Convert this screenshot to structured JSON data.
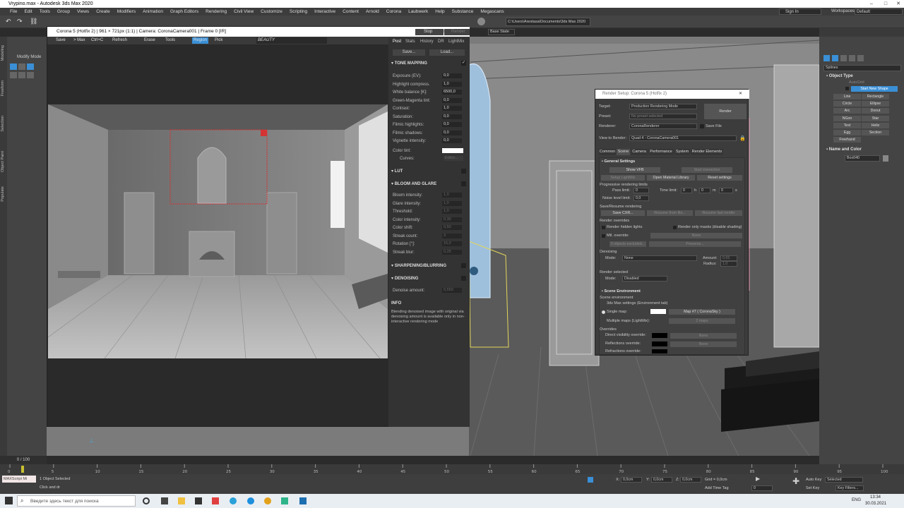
{
  "app": {
    "title": "Vrypino.max - Autodesk 3ds Max 2020"
  },
  "menu": [
    "File",
    "Edit",
    "Tools",
    "Group",
    "Views",
    "Create",
    "Modifiers",
    "Animation",
    "Graph Editors",
    "Rendering",
    "Civil View",
    "Customize",
    "Scripting",
    "Interactive",
    "Content",
    "Arnold",
    "Corona",
    "Laubwerk",
    "Help",
    "Substance",
    "Megascans"
  ],
  "topright": {
    "signin": "Sign In",
    "workspaces_label": "Workspaces:",
    "workspace": "Default"
  },
  "toolbar": {
    "basestate": "Base State",
    "path": "C:\\Users\\Arestasa\\Documents\\3ds Max 2020"
  },
  "leftpanel": {
    "tabs": [
      "Modeling",
      "Freeform",
      "Selection",
      "Object Paint",
      "Populate"
    ],
    "modify_mode": "Modify Mode"
  },
  "vfb": {
    "title": "Corona 5 (Hotfix 2) | 961 × 721px (1:1) | Camera: CoronaCamera001 | Frame 0 [IR]",
    "buttons": [
      "Save",
      "> Max",
      "Ctrl+C",
      "Refresh",
      "Erase",
      "Tools",
      "Region",
      "Pick"
    ],
    "channel": "BEAUTY",
    "stop": "Stop",
    "render": "Render",
    "tabs": [
      "Post",
      "Stats",
      "History",
      "DR",
      "LightMix"
    ],
    "save": "Save...",
    "load": "Load...",
    "tone_mapping": "TONE MAPPING",
    "params": [
      {
        "label": "Exposure (EV):",
        "value": "0,0"
      },
      {
        "label": "Highlight compress.",
        "value": "1,0"
      },
      {
        "label": "White balance [K]:",
        "value": "6500,0"
      },
      {
        "label": "Green-Magenta tint:",
        "value": "0,0"
      },
      {
        "label": "Contrast:",
        "value": "1,0"
      },
      {
        "label": "Saturation:",
        "value": "0,0"
      },
      {
        "label": "Filmic highlights:",
        "value": "0,0"
      },
      {
        "label": "Filmic shadows:",
        "value": "0,0"
      },
      {
        "label": "Vignette intensity:",
        "value": "0,0"
      }
    ],
    "color_tint": "Color tint:",
    "curves": "Curves:",
    "curves_btn": "Editor...",
    "lut": "LUT",
    "bloom": "BLOOM AND GLARE",
    "bloom_params": [
      {
        "label": "Bloom intensity:",
        "value": "1,0"
      },
      {
        "label": "Glare intensity:",
        "value": "1,0"
      },
      {
        "label": "Threshold:",
        "value": "1,0"
      },
      {
        "label": "Color intensity:",
        "value": "0,30"
      },
      {
        "label": "Color shift:",
        "value": "0,50"
      },
      {
        "label": "Streak count:",
        "value": "3"
      },
      {
        "label": "Rotation [°]:",
        "value": "15,0"
      },
      {
        "label": "Streak blur:",
        "value": "0,25"
      }
    ],
    "sharpen": "SHARPENING/BLURRING",
    "denoising": "DENOISING",
    "denoise_amount": "Denoise amount:",
    "denoise_value": "0,650",
    "info_title": "INFO",
    "info_text": "Blending denoised image with original via denoising amount is available only in non-interactive rendering mode"
  },
  "render_setup": {
    "title": "Render Setup: Corona 5 (Hotfix 2)",
    "target_label": "Target:",
    "target": "Production Rendering Mode",
    "preset_label": "Preset:",
    "preset": "No preset selected",
    "renderer_label": "Renderer:",
    "renderer": "CoronaRenderer",
    "savefile": "Save File",
    "view_label": "View to Render:",
    "view": "Quad 4 - CoronaCamera001",
    "render_btn": "Render",
    "tabs": [
      "Common",
      "Scene",
      "Camera",
      "Performance",
      "System",
      "Render Elements"
    ],
    "general": "General Settings",
    "show_vfb": "Show VFB",
    "start_interactive": "Start interactive",
    "setup_lightmix": "Setup LightMix",
    "open_material": "Open Material Library",
    "reset": "Reset settings",
    "prog_limits": "Progressive rendering limits",
    "pass_limit": "Pass limit:",
    "pass_val": "0",
    "time_limit": "Time limit:",
    "h": "0",
    "hl": "h",
    "m": "0",
    "ml": "m",
    "s": "0",
    "sl": "s",
    "noise_label": "Noise level limit:",
    "noise_val": "0,0",
    "save_resume": "Save/Resume rendering",
    "save_cxr": "Save CXR...",
    "resume_file": "Resume from file...",
    "resume_last": "Resume last render",
    "overrides": "Render overrides",
    "hidden_lights": "Render hidden lights",
    "only_masks": "Render only masks (disable shading)",
    "mtl_override": "Mtl. override:",
    "none": "None",
    "objects_excluded": "0 objects excluded...",
    "preserve": "Preserve...",
    "denoising": "Denoising",
    "mode_label": "Mode:",
    "mode": "None",
    "amount_label": "Amount:",
    "amount_val": "0,65",
    "radius_label": "Radius:",
    "radius_val": "1,0",
    "render_selected": "Render selected",
    "rs_mode": "Disabled",
    "scene_env": "Scene Environment",
    "scene_env_sub": "Scene environment",
    "max_settings": "3ds Max settings (Environment tab)",
    "single_map": "Single map:",
    "map": "Map #7  ( CoronaSky )",
    "multiple_maps": "Multiple maps (LightMix):",
    "two_maps": "2 maps",
    "overrides2": "Overrides",
    "direct": "Direct visibility override:",
    "reflections": "Reflections override:",
    "refractions": "Refractions override:"
  },
  "cmd": {
    "category": "Splines",
    "object_type": "Object Type",
    "autogrid": "AutoGrid",
    "start_new": "Start New Shape",
    "buttons": [
      "Line",
      "Rectangle",
      "Circle",
      "Ellipse",
      "Arc",
      "Donut",
      "NGon",
      "Star",
      "Text",
      "Helix",
      "Egg",
      "Section",
      "Freehand"
    ],
    "name_color": "Name and Color",
    "name": "Box040"
  },
  "timeline": {
    "frames": "0 / 100",
    "ticks": [
      "0",
      "5",
      "10",
      "15",
      "20",
      "25",
      "30",
      "35",
      "40",
      "45",
      "50",
      "55",
      "60",
      "65",
      "70",
      "75",
      "80",
      "85",
      "90",
      "95",
      "100"
    ]
  },
  "status": {
    "script": "MAXScript Mi",
    "selected": "1 Object Selected",
    "hint": "Click and dr",
    "x": "0,0cm",
    "y": "0,0cm",
    "z": "0,0cm",
    "grid": "Grid = 0,0cm",
    "add_time_tag": "Add Time Tag",
    "frame": "0",
    "autokey": "Auto Key",
    "setkey": "Set Key",
    "selected_drop": "Selected",
    "keyfilters": "Key Filters..."
  },
  "taskbar": {
    "search": "Введите здесь текст для поиска",
    "lang": "ENG",
    "time": "13:34",
    "date": "30.03.2021"
  },
  "colors": {
    "accent": "#3a8fd6",
    "region": "#d43434",
    "selection": "#e2d65a"
  }
}
